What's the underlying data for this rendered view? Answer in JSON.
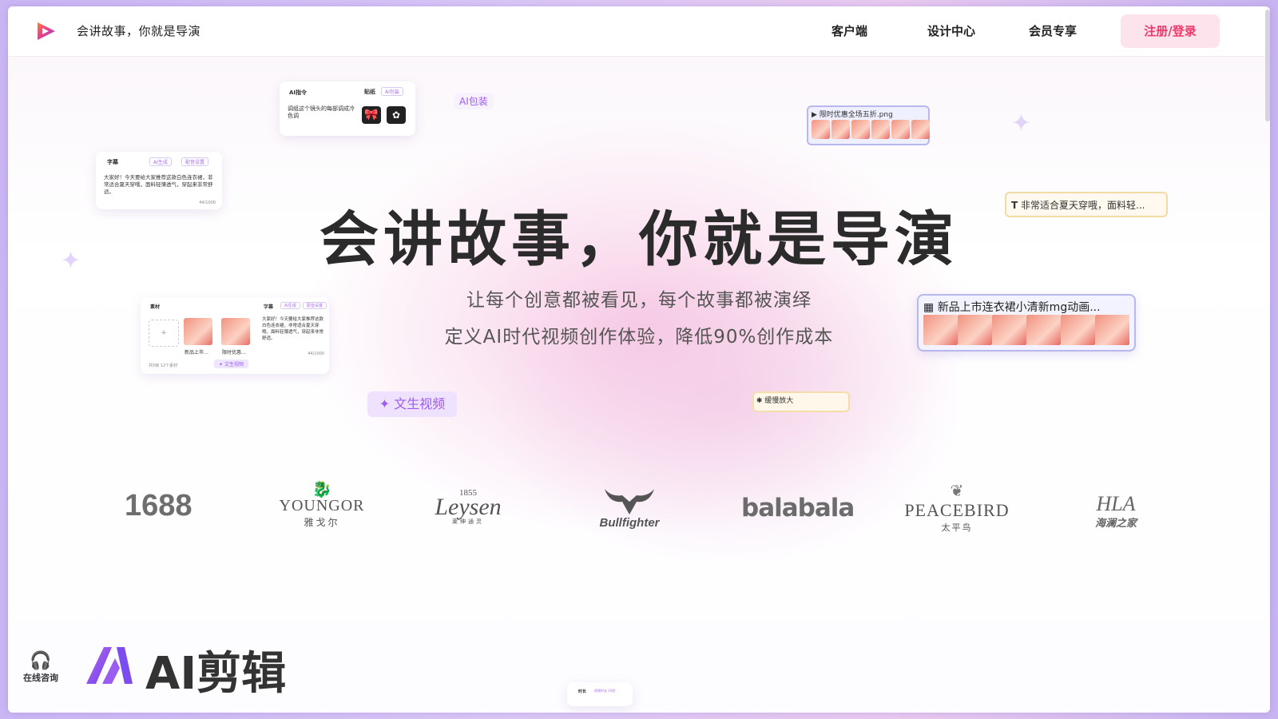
{
  "header": {
    "brand_text": "会讲故事，你就是导演",
    "nav": [
      "客户端",
      "设计中心",
      "会员专享"
    ],
    "login_label": "注册/登录"
  },
  "hero": {
    "title": "会讲故事，你就是导演",
    "subtitle_1": "让每个创意都被看见，每个故事都被演绎",
    "subtitle_2": "定义AI时代视频创作体验，降低90%创作成本"
  },
  "cards": {
    "ai_command": {
      "title": "AI指令",
      "tab_sticker": "贴纸",
      "tab_pack": "AI包装",
      "text": "调组这个镜头的每部调成冷色调"
    },
    "ai_pack_label": "AI包装",
    "subtitle_card": {
      "title": "字幕",
      "tag_gen": "AI生成",
      "tag_voice": "配音设置",
      "text": "大家好！今天要给大家推荐这款白色连衣裙，非常适合夏天穿哦，面料轻薄透气，穿起来非常舒适。",
      "count": "44/1000"
    },
    "png_card": {
      "label": "限时优惠全场五折.png"
    },
    "text_card": {
      "label": "非常适合夏天穿哦，面料轻..."
    },
    "material_card": {
      "title": "素材",
      "tab_sub": "字幕",
      "tag_gen": "AI生成",
      "tag_voice": "配音设置",
      "item1": "新品上市…",
      "item2": "限时优惠…",
      "footer": "共5帧 12个素材",
      "btn": "文生视频",
      "text": "大家好！今天要给大家推荐这款白色连衣裙，非常适合夏天穿哦，面料轻薄透气，穿起来非常舒适。",
      "count": "44/1000"
    },
    "video_card": {
      "label": "新品上市连衣裙小清新mg动画..."
    },
    "text2video_label": "文生视频",
    "zoom_label": "缓慢放大",
    "bottom_card_label": "时长",
    "bottom_card_tag": "视频时长 10秒"
  },
  "brands": [
    "1688",
    "YOUNGOR",
    "雅戈尔",
    "1855",
    "Leysen",
    "莱绅通灵",
    "Bullfighter",
    "balabala",
    "PEACEBIRD",
    "太平鸟",
    "HLA",
    "海澜之家"
  ],
  "footer": {
    "ai_edit": "AI剪辑",
    "consult": "在线咨询"
  },
  "colors": {
    "accent": "#f0386a",
    "purple": "#9b5cf0",
    "title": "#2b2b2b"
  }
}
